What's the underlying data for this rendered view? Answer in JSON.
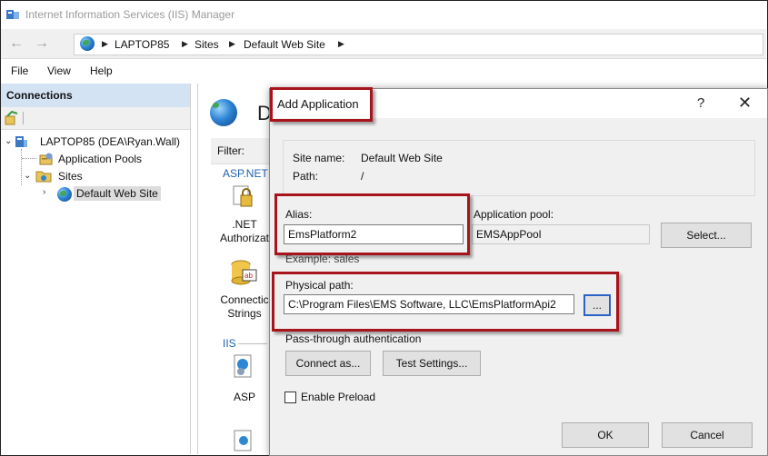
{
  "window": {
    "title": "Internet Information Services (IIS) Manager"
  },
  "address_bar": {
    "breadcrumbs": [
      "LAPTOP85",
      "Sites",
      "Default Web Site"
    ]
  },
  "menu": {
    "items": [
      "File",
      "View",
      "Help"
    ]
  },
  "connections": {
    "header": "Connections",
    "tree": {
      "server": "LAPTOP85 (DEA\\Ryan.Wall)",
      "app_pools": "Application Pools",
      "sites": "Sites",
      "default_site": "Default Web Site"
    }
  },
  "main": {
    "title_fragment": "D",
    "filter_label": "Filter:",
    "section_aspnet": "ASP.NET",
    "net_authorization_line1": ".NET",
    "net_authorization_line2": "Authorizat",
    "connection_strings_line1": "Connectic",
    "connection_strings_line2": "Strings",
    "section_iis": "IIS",
    "asp_label": "ASP"
  },
  "dialog": {
    "title": "Add Application",
    "help": "?",
    "close": "✕",
    "site_name_label": "Site name:",
    "site_name_value": "Default Web Site",
    "path_label": "Path:",
    "path_value": "/",
    "alias_label": "Alias:",
    "alias_value": "EmsPlatform2",
    "example_text": "Example: sales",
    "app_pool_label": "Application pool:",
    "app_pool_value": "EMSAppPool",
    "select_button": "Select...",
    "physical_path_label": "Physical path:",
    "physical_path_value": "C:\\Program Files\\EMS Software, LLC\\EmsPlatformApi2",
    "browse_button": "...",
    "pass_through_label": "Pass-through authentication",
    "connect_as_button": "Connect as...",
    "test_settings_button": "Test Settings...",
    "enable_preload_label": "Enable Preload",
    "enable_preload_checked": false,
    "ok_button": "OK",
    "cancel_button": "Cancel"
  },
  "colors": {
    "annotation_red": "#a8141c",
    "connections_header_bg": "#d4e3f4",
    "focus_blue": "#2a62c6"
  }
}
